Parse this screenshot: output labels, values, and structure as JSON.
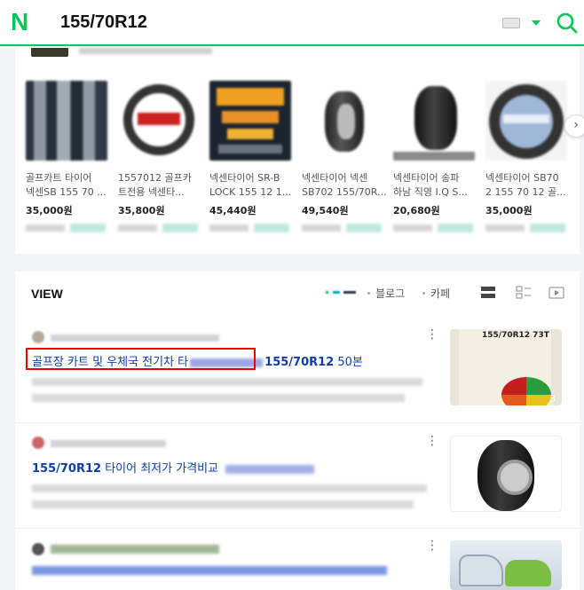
{
  "header": {
    "logo": "N",
    "query": "155/70R12",
    "keyboard_icon": "keyboard-icon",
    "search_icon": "search-icon",
    "accent": "#03c75a"
  },
  "shopping": {
    "products": [
      {
        "name_line1": "골프카트 타이어",
        "name_line2": "넥센SB 155 70 ...",
        "price": "35,000원"
      },
      {
        "name_line1": "1557012 골프카",
        "name_line2": "트전용 넥센타...",
        "price": "35,800원"
      },
      {
        "name_line1": "넥센타이어 SR-B",
        "name_line2": "LOCK 155 12 1...",
        "price": "45,440원"
      },
      {
        "name_line1": "넥센타이어 넥센",
        "name_line2": "SB702 155/70R...",
        "price": "49,540원"
      },
      {
        "name_line1": "넥센타이어 송파",
        "name_line2": "하남 직영 I.Q S...",
        "price": "20,680원"
      },
      {
        "name_line1": "넥센타이어 SB70",
        "name_line2": "2 155 70 12 골...",
        "price": "35,000원"
      }
    ],
    "next_icon": "chevron-right-icon"
  },
  "view": {
    "title": "VIEW",
    "tab_blog": "블로그",
    "tab_cafe": "카페",
    "posts": [
      {
        "title_part1": "골프장 카트 및 우체국 전기차 타",
        "title_query": "155/70R12",
        "title_tail": " 50본",
        "image_count": "3",
        "image_text": "155/70R12 73T"
      },
      {
        "title_query": "155/70R12",
        "title_rest": " 타이어 최저가 가격비교"
      },
      {}
    ]
  }
}
